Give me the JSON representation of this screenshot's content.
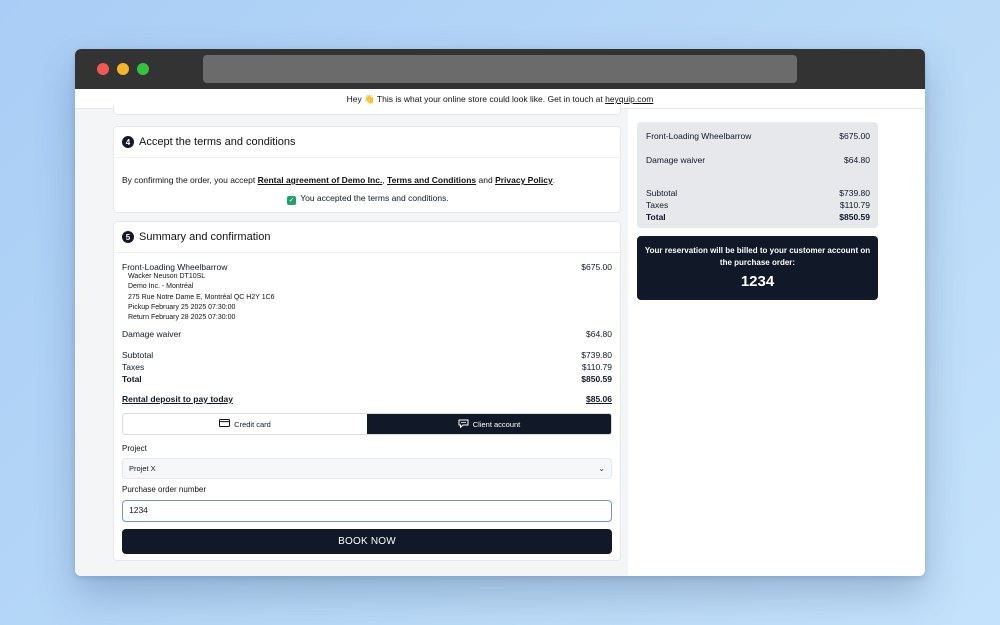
{
  "promo": {
    "text_before": "Hey 👋 This is what your online store could look like. Get in touch at ",
    "link": "heyquip.com"
  },
  "terms": {
    "step": "4",
    "title": "Accept the terms and conditions",
    "intro": "By confirming the order, you accept ",
    "link_rental": "Rental agreement of Demo Inc.",
    "sep1": ", ",
    "link_terms": "Terms and Conditions",
    "sep2": " and ",
    "link_privacy": "Privacy Policy",
    "end": ".",
    "accepted": "You accepted the terms and conditions."
  },
  "summary": {
    "step": "5",
    "title": "Summary and confirmation",
    "item_name": "Front-Loading Wheelbarrow",
    "item_price": "$675.00",
    "details": [
      "Wacker Neuson DT10SL",
      "Demo Inc. - Montréal",
      "275 Rue Notre Dame E, Montréal QC H2Y 1C6",
      "Pickup February 25 2025 07:30:00",
      "Return February 28 2025 07:30:00"
    ],
    "waiver_label": "Damage waiver",
    "waiver_price": "$64.80",
    "subtotal_label": "Subtotal",
    "subtotal": "$739.80",
    "taxes_label": "Taxes",
    "taxes": "$110.79",
    "total_label": "Total",
    "total": "$850.59",
    "deposit_label": "Rental deposit to pay today",
    "deposit": "$85.06"
  },
  "payment": {
    "tab_credit": "Credit card",
    "tab_client": "Client account",
    "active": "Client account",
    "project_label": "Project",
    "project_value": "Projet X",
    "po_label": "Purchase order number",
    "po_value": "1234",
    "book_label": "BOOK NOW"
  },
  "sidebar": {
    "item_name": "Front-Loading Wheelbarrow",
    "item_price": "$675.00",
    "waiver_label": "Damage waiver",
    "waiver_price": "$64.80",
    "subtotal_label": "Subtotal",
    "subtotal": "$739.80",
    "taxes_label": "Taxes",
    "taxes": "$110.79",
    "total_label": "Total",
    "total": "$850.59",
    "billing_note": "Your reservation will be billed to your customer account on the purchase order:",
    "po_number": "1234"
  },
  "colors": {
    "dark": "#111827",
    "check": "#22a06b",
    "focus": "#6f93d6"
  },
  "icons": [
    "credit-card-icon",
    "client-account-icon",
    "chevron-down-icon",
    "check-icon",
    "wave-emoji"
  ]
}
